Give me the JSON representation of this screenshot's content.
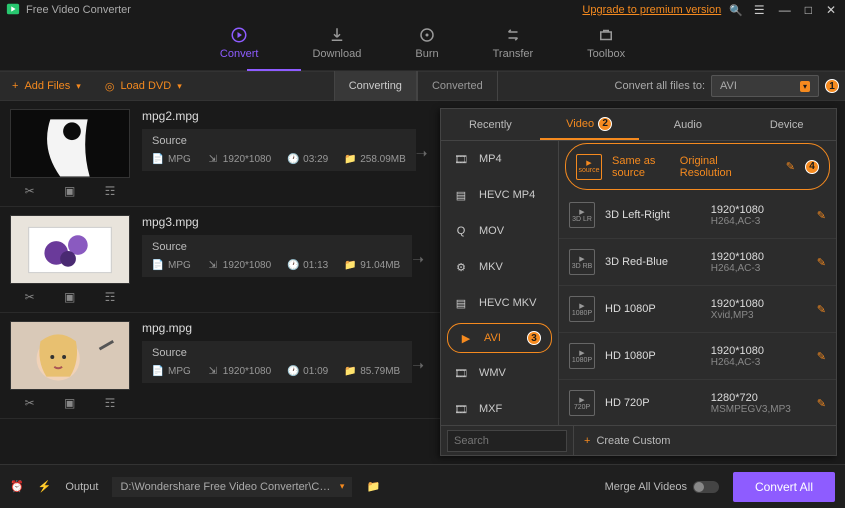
{
  "titlebar": {
    "appname": "Free Video Converter",
    "upgrade": "Upgrade to premium version"
  },
  "nav": {
    "convert": "Convert",
    "download": "Download",
    "burn": "Burn",
    "transfer": "Transfer",
    "toolbox": "Toolbox"
  },
  "toolbar": {
    "add_files": "Add Files",
    "load_dvd": "Load DVD",
    "converting": "Converting",
    "converted": "Converted",
    "convert_all_label": "Convert all files to:",
    "selected_format": "AVI"
  },
  "markers": {
    "m1": "1",
    "m2": "2",
    "m3": "3",
    "m4": "4"
  },
  "files": [
    {
      "name": "mpg2.mpg",
      "source": "Source",
      "codec": "MPG",
      "res": "1920*1080",
      "dur": "03:29",
      "size": "258.09MB"
    },
    {
      "name": "mpg3.mpg",
      "source": "Source",
      "codec": "MPG",
      "res": "1920*1080",
      "dur": "01:13",
      "size": "91.04MB"
    },
    {
      "name": "mpg.mpg",
      "source": "Source",
      "codec": "MPG",
      "res": "1920*1080",
      "dur": "01:09",
      "size": "85.79MB"
    }
  ],
  "panel": {
    "tabs": {
      "recently": "Recently",
      "video": "Video",
      "audio": "Audio",
      "device": "Device"
    },
    "formats": [
      "MP4",
      "HEVC MP4",
      "MOV",
      "MKV",
      "HEVC MKV",
      "AVI",
      "WMV",
      "MXF"
    ],
    "profiles": [
      {
        "name": "Same as source",
        "desc": "",
        "res": "Original Resolution",
        "codec": ""
      },
      {
        "name": "3D Left-Right",
        "desc": "",
        "res": "1920*1080",
        "codec": "H264,AC-3"
      },
      {
        "name": "3D Red-Blue",
        "desc": "",
        "res": "1920*1080",
        "codec": "H264,AC-3"
      },
      {
        "name": "HD 1080P",
        "desc": "",
        "res": "1920*1080",
        "codec": "Xvid,MP3"
      },
      {
        "name": "HD 1080P",
        "desc": "",
        "res": "1920*1080",
        "codec": "H264,AC-3"
      },
      {
        "name": "HD 720P",
        "desc": "",
        "res": "1280*720",
        "codec": "MSMPEGV3,MP3"
      }
    ],
    "search_placeholder": "Search",
    "create_custom": "Create Custom"
  },
  "bottombar": {
    "output_label": "Output",
    "output_path": "D:\\Wondershare Free Video Converter\\Converted",
    "merge_label": "Merge All Videos",
    "convert_all": "Convert All"
  }
}
